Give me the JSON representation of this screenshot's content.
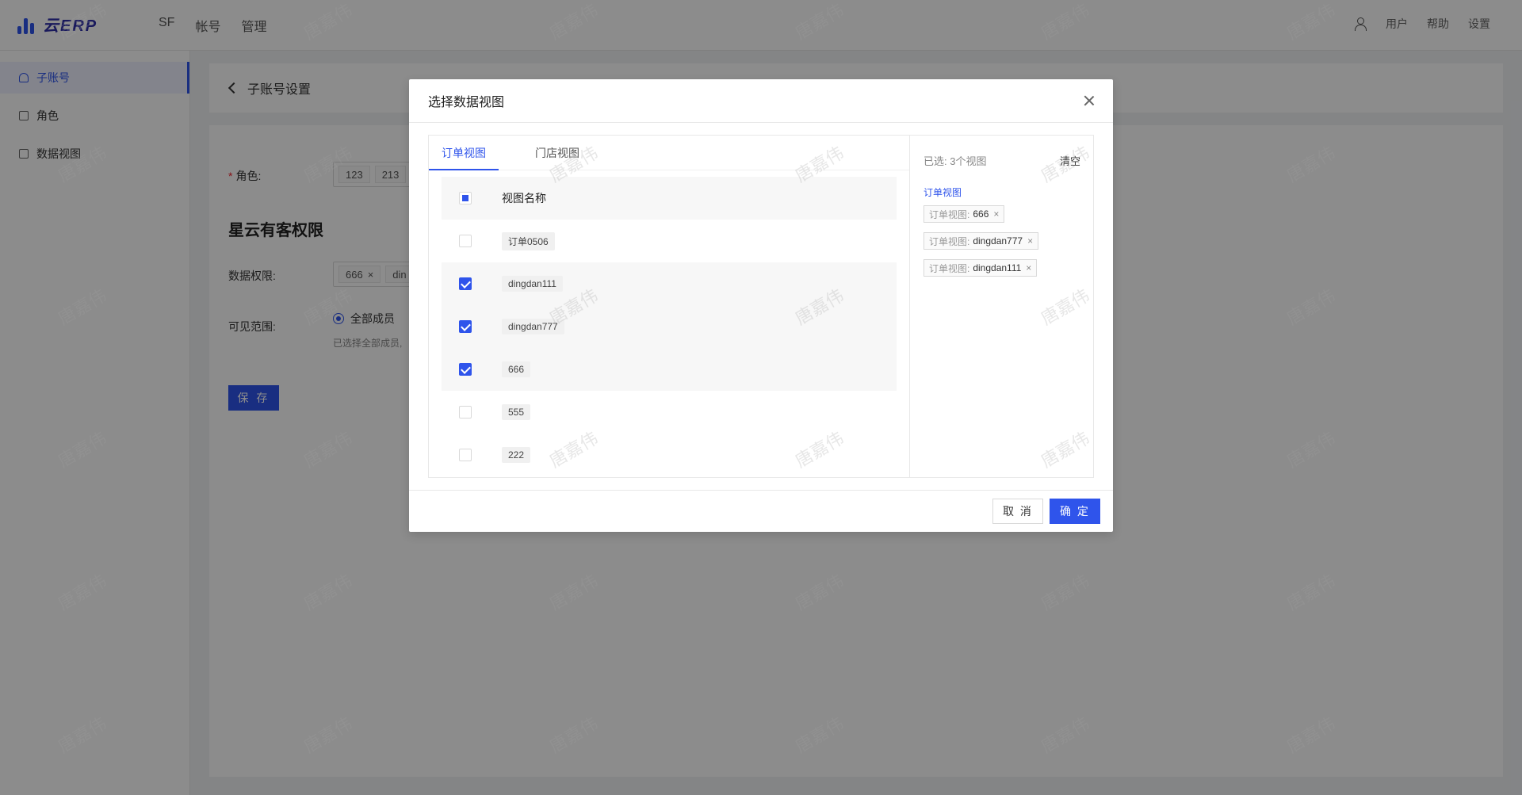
{
  "topbar": {
    "logo_text": "云ERP",
    "nav": [
      "SF",
      "帐号",
      "管理"
    ],
    "right": [
      "用户",
      "帮助",
      "设置"
    ]
  },
  "sidebar": {
    "items": [
      {
        "label": "子账号",
        "active": true
      },
      {
        "label": "角色",
        "active": false
      },
      {
        "label": "数据视图",
        "active": false
      }
    ]
  },
  "header": {
    "title": "子账号设置"
  },
  "form": {
    "role_label": "角色:",
    "roles": [
      "123",
      "213"
    ],
    "section_title": "星云有客权限",
    "data_perm_label": "数据权限:",
    "data_perm_tags": [
      "666",
      "din"
    ],
    "visible_label": "可见范围:",
    "visible_option": "全部成员",
    "visible_hint": "已选择全部成员,",
    "save_label": "保 存"
  },
  "modal": {
    "title": "选择数据视图",
    "tabs": [
      {
        "label": "订单视图",
        "active": true
      },
      {
        "label": "门店视图",
        "active": false
      }
    ],
    "header_col": "视图名称",
    "rows": [
      {
        "label": "订单0506",
        "checked": false
      },
      {
        "label": "dingdan111",
        "checked": true
      },
      {
        "label": "dingdan777",
        "checked": true
      },
      {
        "label": "666",
        "checked": true
      },
      {
        "label": "555",
        "checked": false
      },
      {
        "label": "222",
        "checked": false
      }
    ],
    "selected_count_text": "已选: 3个视图",
    "clear_label": "清空",
    "selected_group": "订单视图",
    "selected_tags": [
      {
        "prefix": "订单视图:",
        "label": "666"
      },
      {
        "prefix": "订单视图:",
        "label": "dingdan777"
      },
      {
        "prefix": "订单视图:",
        "label": "dingdan111"
      }
    ],
    "cancel_label": "取 消",
    "ok_label": "确 定"
  },
  "watermark": "唐嘉伟",
  "colors": {
    "primary": "#2f54eb",
    "mask": "rgba(0,0,0,0.45)"
  }
}
